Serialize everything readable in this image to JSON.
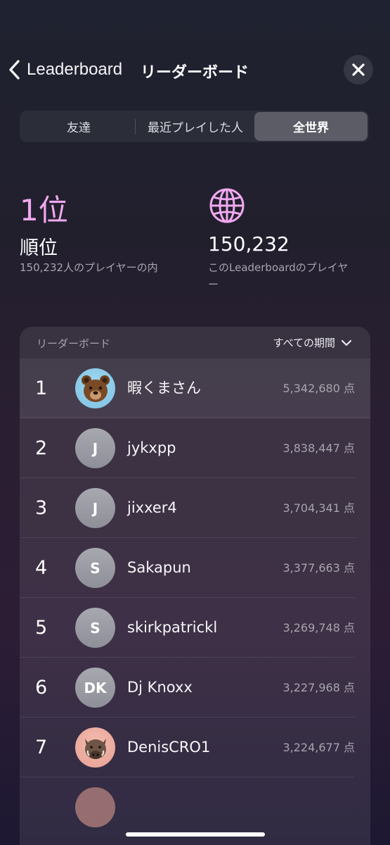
{
  "header": {
    "back_label": "Leaderboard",
    "title": "リーダーボード"
  },
  "tabs": [
    {
      "label": "友達",
      "selected": false
    },
    {
      "label": "最近プレイした人",
      "selected": false
    },
    {
      "label": "全世界",
      "selected": true
    }
  ],
  "stats": {
    "rank_value": "1位",
    "rank_label": "順位",
    "rank_sub": "150,232人のプレイヤーの内",
    "players_count": "150,232",
    "players_sub": "このLeaderboardのプレイヤー"
  },
  "board": {
    "title": "リーダーボード",
    "period": "すべての期間"
  },
  "rows": [
    {
      "rank": "1",
      "name": "暇くまさん",
      "score": "5,342,680 点",
      "avatar": "bear-avatar"
    },
    {
      "rank": "2",
      "name": "jykxpp",
      "score": "3,838,447 点",
      "initials": "J"
    },
    {
      "rank": "3",
      "name": "jixxer4",
      "score": "3,704,341 点",
      "initials": "J"
    },
    {
      "rank": "4",
      "name": "Sakapun",
      "score": "3,377,663 点",
      "initials": "S"
    },
    {
      "rank": "5",
      "name": "skirkpatrickl",
      "score": "3,269,748 点",
      "initials": "S"
    },
    {
      "rank": "6",
      "name": "Dj Knoxx",
      "score": "3,227,968 点",
      "initials": "DK"
    },
    {
      "rank": "7",
      "name": "DenisCRO1",
      "score": "3,224,677 点",
      "avatar": "boar-avatar"
    }
  ],
  "colors": {
    "accent_pink": "#f0a9ef",
    "selected_segment": "#5b5c66"
  }
}
